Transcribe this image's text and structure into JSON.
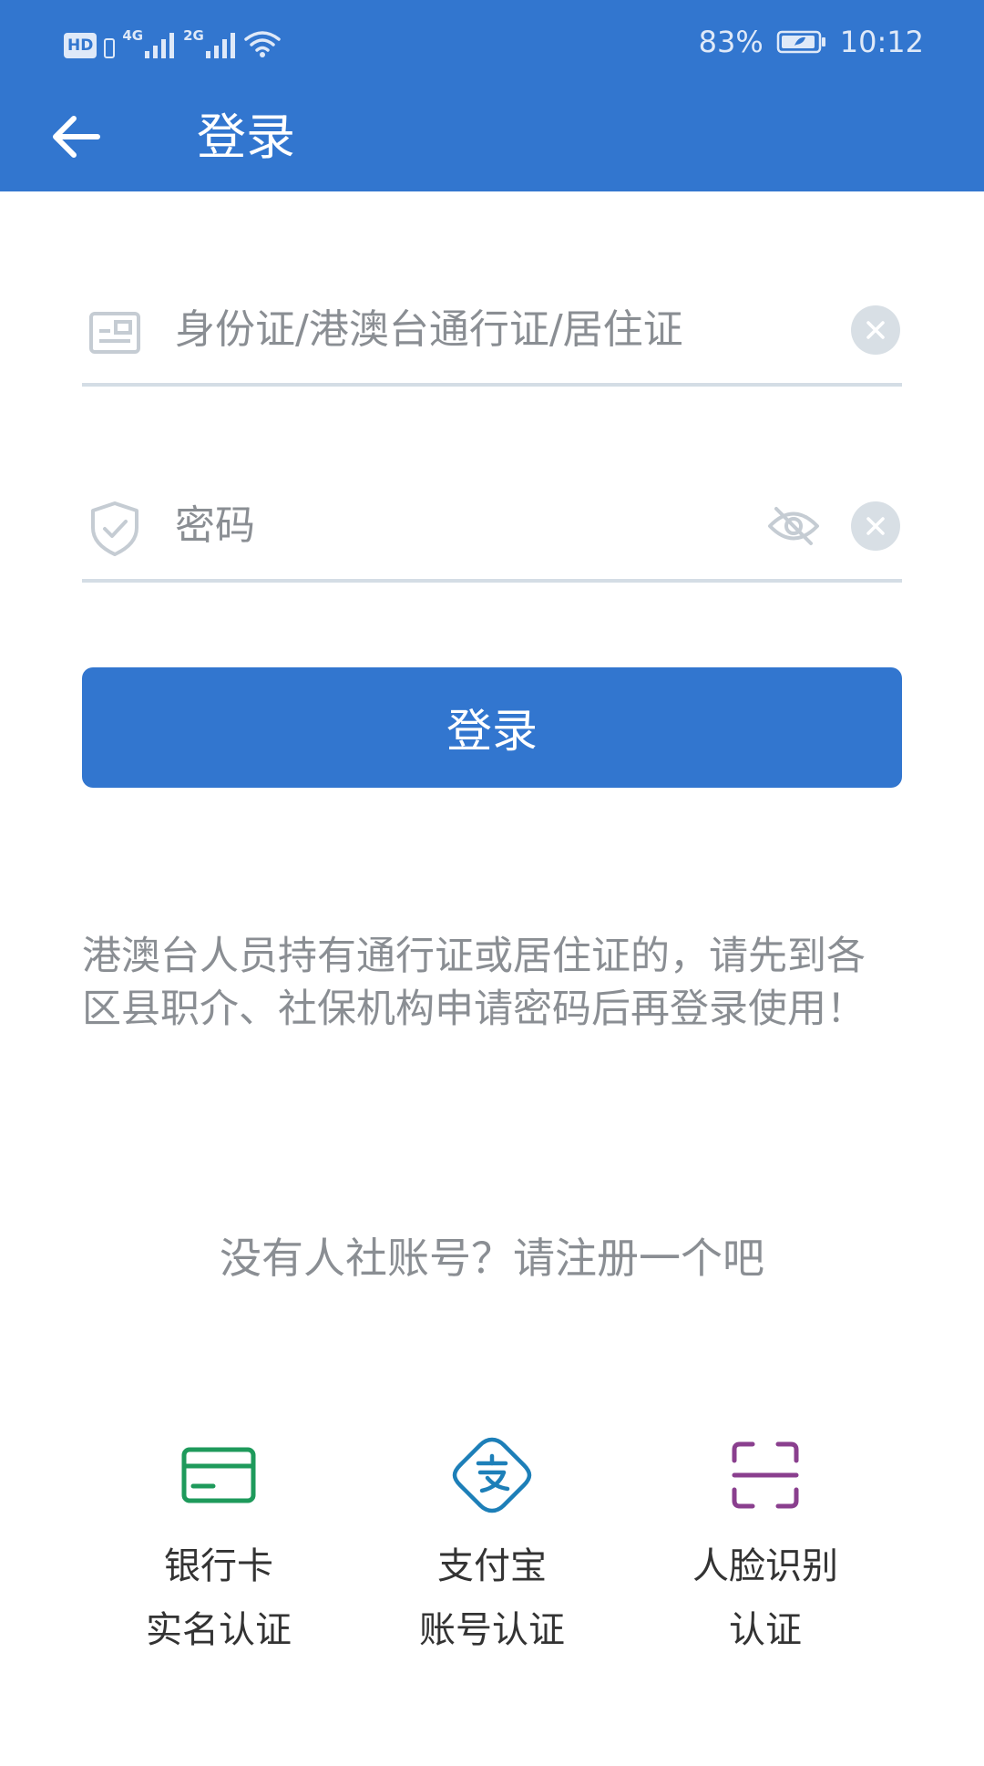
{
  "status_bar": {
    "hd_label": "HD",
    "signal_1_label": "4G",
    "signal_2_label": "2G",
    "battery": "83%",
    "time": "10:12"
  },
  "toolbar": {
    "title": "登录"
  },
  "id_field": {
    "placeholder": "身份证/港澳台通行证/居住证",
    "value": ""
  },
  "password_field": {
    "placeholder": "密码",
    "value": ""
  },
  "login_button": {
    "label": "登录"
  },
  "notice": "港澳台人员持有通行证或居住证的，请先到各区县职介、社保机构申请密码后再登录使用！",
  "register_link": "没有人社账号？请注册一个吧",
  "auth_options": [
    {
      "line1": "银行卡",
      "line2": "实名认证",
      "icon": "bank-card-icon",
      "color": "#1e9a5b"
    },
    {
      "line1": "支付宝",
      "line2": "账号认证",
      "icon": "alipay-icon",
      "color": "#1d7fb8"
    },
    {
      "line1": "人脸识别",
      "line2": "认证",
      "icon": "face-scan-icon",
      "color": "#8a3f8e"
    }
  ],
  "colors": {
    "primary": "#3276cf",
    "hint_text": "#8a8e93",
    "divider": "#d4dde5"
  }
}
